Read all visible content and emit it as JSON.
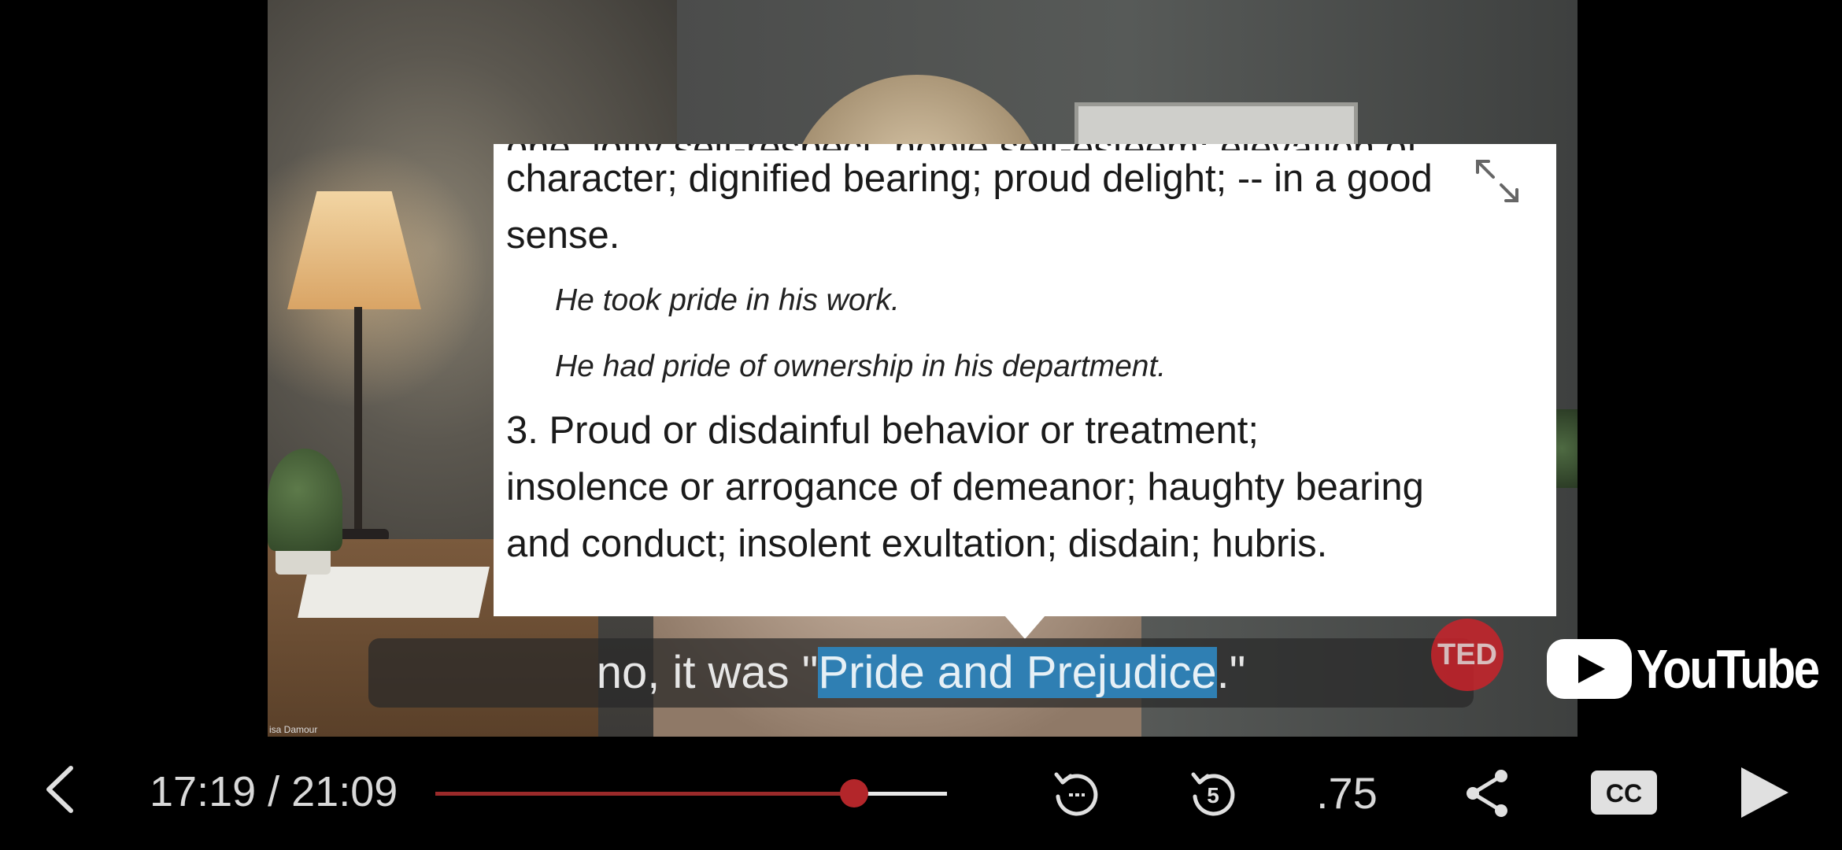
{
  "video": {
    "speaker_tag": "isa Damour"
  },
  "popup": {
    "clipped_line": "one, lofty self-respect, noble self-esteem; elevation of",
    "lines": [
      "character; dignified bearing; proud delight; -- in a good",
      "sense."
    ],
    "examples": [
      "He took pride in his work.",
      "He had pride of ownership in his department."
    ],
    "definition_3": [
      "3. Proud or disdainful behavior or treatment;",
      "insolence or arrogance of demeanor; haughty bearing",
      "and conduct; insolent exultation; disdain; hubris."
    ],
    "expand_icon": "expand-arrows-icon"
  },
  "caption": {
    "before": "no, it was \"",
    "highlight": "Pride and Prejudice",
    "after": ".\""
  },
  "branding": {
    "ted": "TED",
    "youtube": "YouTube"
  },
  "controls": {
    "time": "17:19 / 21:09",
    "progress_fraction": 0.818,
    "speed": ".75",
    "icons": [
      "back-icon",
      "replay-icon",
      "rewind-5-icon",
      "share-icon",
      "cc-icon",
      "play-icon"
    ],
    "accent_color": "#b3262a"
  }
}
